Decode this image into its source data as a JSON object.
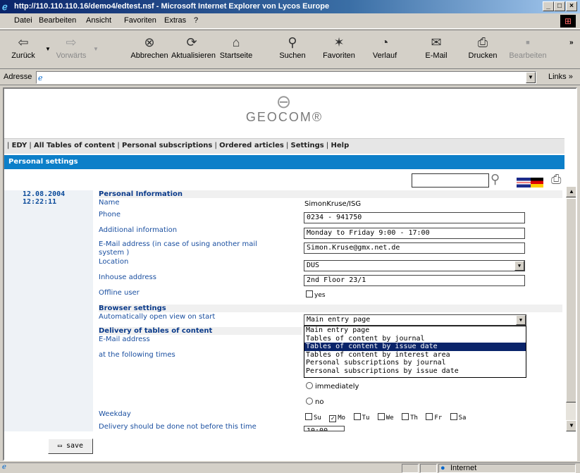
{
  "window": {
    "title": "http://110.110.110.16/demo4/edtest.nsf - Microsoft Internet Explorer von Lycos Europe"
  },
  "menu": [
    "Datei",
    "Bearbeiten",
    "Ansicht",
    "Favoriten",
    "Extras",
    "?"
  ],
  "toolbar": [
    {
      "label": "Zurück",
      "icon": "back-arrow-icon",
      "enabled": true
    },
    {
      "label": "Vorwärts",
      "icon": "forward-arrow-icon",
      "enabled": false
    },
    {
      "label": "Abbrechen",
      "icon": "stop-icon",
      "enabled": true
    },
    {
      "label": "Aktualisieren",
      "icon": "refresh-icon",
      "enabled": true
    },
    {
      "label": "Startseite",
      "icon": "home-icon",
      "enabled": true
    },
    {
      "label": "Suchen",
      "icon": "search-icon",
      "enabled": true
    },
    {
      "label": "Favoriten",
      "icon": "favorites-icon",
      "enabled": true
    },
    {
      "label": "Verlauf",
      "icon": "history-icon",
      "enabled": true
    },
    {
      "label": "E-Mail",
      "icon": "mail-icon",
      "enabled": true
    },
    {
      "label": "Drucken",
      "icon": "print-icon",
      "enabled": true
    },
    {
      "label": "Bearbeiten",
      "icon": "edit-icon",
      "enabled": false
    }
  ],
  "address": {
    "label": "Adresse",
    "value": "",
    "links_label": "Links"
  },
  "page": {
    "logo_text": "GEOCOM®",
    "nav": [
      "EDY",
      "All Tables of content",
      "Personal subscriptions",
      "Ordered articles",
      "Settings",
      "Help"
    ],
    "header": "Personal settings",
    "date": "12.08.2004",
    "time": "12:22:11",
    "personal": {
      "section": "Personal Information",
      "name_label": "Name",
      "name_value": "SimonKruse/ISG",
      "phone_label": "Phone",
      "phone_value": "0234 - 941750",
      "additional_label": "Additional information",
      "additional_value": "Monday to Friday 9:00 - 17:00",
      "email_label": "E-Mail address (in case of using another mail system )",
      "email_value": "Simon.Kruse@gmx.net.de",
      "location_label": "Location",
      "location_value": "DUS",
      "inhouse_label": "Inhouse address",
      "inhouse_value": "2nd Floor 23/1",
      "offline_label": "Offline user",
      "offline_option": "yes"
    },
    "browser": {
      "section": "Browser settings",
      "auto_label": "Automatically open view on start",
      "auto_value": "Main entry page",
      "options": [
        "Main entry page",
        "Tables of content by journal",
        "Tables of content by issue date",
        "Tables of content by interest area",
        "Personal subscriptions by journal",
        "Personal subscriptions by issue date"
      ],
      "highlighted_index": 2
    },
    "delivery": {
      "section": "Delivery of tables of content",
      "email_label": "E-Mail address",
      "times_label": "at the following times",
      "radio_immediately": "immediately",
      "radio_no": "no",
      "weekday_label": "Weekday",
      "weekdays": [
        {
          "label": "Su",
          "checked": false
        },
        {
          "label": "Mo",
          "checked": true
        },
        {
          "label": "Tu",
          "checked": false
        },
        {
          "label": "We",
          "checked": false
        },
        {
          "label": "Th",
          "checked": false
        },
        {
          "label": "Fr",
          "checked": false
        },
        {
          "label": "Sa",
          "checked": false
        }
      ],
      "notbefore_label": "Delivery should be done not before this time",
      "notbefore_value": "10:00"
    },
    "save_label": "save"
  },
  "status": {
    "zone": "Internet"
  }
}
